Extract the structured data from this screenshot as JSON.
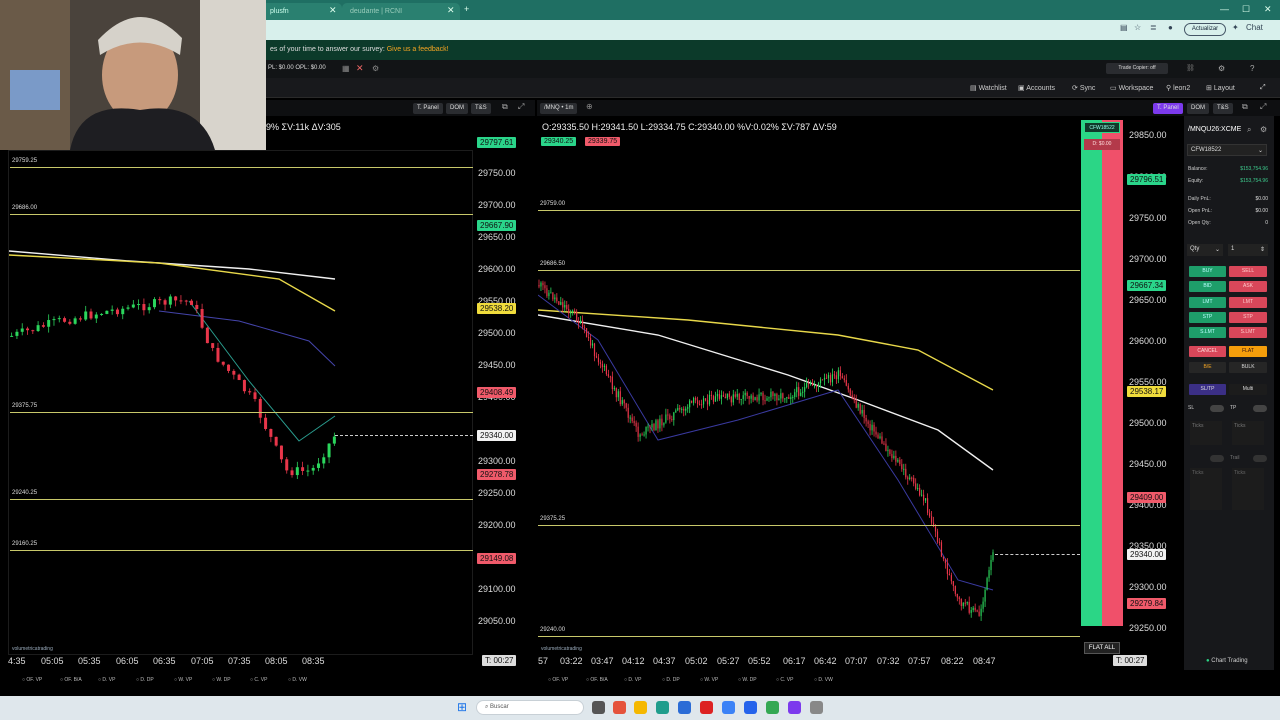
{
  "browser": {
    "tab1_title": "plusfn",
    "tab2_title": "deudante | RCNI",
    "actualizar_label": "Actualizar",
    "chat_label": "Chat"
  },
  "banner": {
    "text": "es of your time to answer our survey:",
    "link": "Give us a feedback!"
  },
  "toolbar": {
    "pnl_text": "PL: $0.00  OPL: $0.00",
    "trade_copier": "Trade Copier: off"
  },
  "nav": {
    "watchlist": "Watchlist",
    "accounts": "Accounts",
    "sync": "Sync",
    "workspace": "Workspace",
    "user": "leon2",
    "layout": "Layout"
  },
  "left_chart": {
    "buttons": [
      "T. Panel",
      "DOM",
      "T&S"
    ],
    "stats": "9%  ΣV:11k  ΔV:305",
    "levels": [
      {
        "price": "29759.25"
      },
      {
        "price": "29686.00"
      },
      {
        "price": "29375.75"
      },
      {
        "price": "29240.25"
      },
      {
        "price": "29160.25"
      }
    ],
    "price_labels": [
      "29750.00",
      "29700.00",
      "29650.00",
      "29600.00",
      "29550.00",
      "29500.00",
      "29450.00",
      "29400.00",
      "29300.00",
      "29250.00",
      "29200.00",
      "29100.00",
      "29050.00"
    ],
    "boxes": [
      {
        "text": "29797.61",
        "cls": "g"
      },
      {
        "text": "29667.90",
        "cls": "g"
      },
      {
        "text": "29538.20",
        "cls": "y"
      },
      {
        "text": "29408.49",
        "cls": "r"
      },
      {
        "text": "29340.00",
        "cls": "w"
      },
      {
        "text": "29278.78",
        "cls": "r"
      },
      {
        "text": "29149.08",
        "cls": "r"
      }
    ],
    "times": [
      "4:35",
      "05:05",
      "05:35",
      "06:05",
      "06:35",
      "07:05",
      "07:35",
      "08:05",
      "08:35"
    ],
    "timer": "T: 00:27",
    "watermark": "volumetricatrading",
    "bottom_items": [
      "OF. VP",
      "OF. B/A",
      "D. VP",
      "D. DP",
      "W. VP",
      "W. DP",
      "C. VP",
      "D. VW"
    ]
  },
  "right_chart": {
    "symbol": "/MNQ",
    "interval": "1m",
    "ohlc": "O:29335.50  H:29341.50  L:29334.75  C:29340.00  %V:0.02%  ΣV:787  ΔV:59",
    "bid_box": "29340.25",
    "ask_box": "29339.75",
    "buttons": [
      "T. Panel",
      "DOM",
      "T&S"
    ],
    "levels": [
      {
        "price": "29759.00"
      },
      {
        "price": "29686.50"
      },
      {
        "price": "29375.25"
      },
      {
        "price": "29240.00"
      }
    ],
    "price_labels": [
      "29850.00",
      "29800.00",
      "29750.00",
      "29700.00",
      "29650.00",
      "29600.00",
      "29550.00",
      "29500.00",
      "29450.00",
      "29400.00",
      "29350.00",
      "29300.00",
      "29250.00"
    ],
    "boxes": [
      {
        "text": "29796.51",
        "cls": "g"
      },
      {
        "text": "29667.34",
        "cls": "g"
      },
      {
        "text": "29538.17",
        "cls": "y"
      },
      {
        "text": "29409.00",
        "cls": "r"
      },
      {
        "text": "29340.00",
        "cls": "w"
      },
      {
        "text": "29279.84",
        "cls": "r"
      }
    ],
    "times": [
      "57",
      "03:22",
      "03:47",
      "04:12",
      "04:37",
      "05:02",
      "05:27",
      "05:52",
      "06:17",
      "06:42",
      "07:07",
      "07:32",
      "07:57",
      "08:22",
      "08:47"
    ],
    "timer": "T: 00:27",
    "account_badge": "CFW18522",
    "pnl_badge": "D: $0.00",
    "flat_all": "FLAT ALL",
    "watermark": "volumetricatrading",
    "bottom_items": [
      "OF. VP",
      "OF. B/A",
      "D. VP",
      "D. DP",
      "W. VP",
      "W. DP",
      "C. VP",
      "D. VW"
    ]
  },
  "trade_panel": {
    "symbol": "/MNQU26:XCME",
    "account": "CFW18522",
    "rows": [
      {
        "label": "Balance:",
        "value": "$153,754.96"
      },
      {
        "label": "Equity:",
        "value": "$153,754.96"
      },
      {
        "label": "Daily PnL:",
        "value": "$0.00"
      },
      {
        "label": "Open PnL:",
        "value": "$0.00"
      },
      {
        "label": "Open Qty:",
        "value": "0"
      }
    ],
    "qty_label": "Qty",
    "qty_value": "1",
    "order_buttons": [
      [
        "BUY",
        "SELL"
      ],
      [
        "BID",
        "ASK"
      ],
      [
        "LMT",
        "LMT"
      ],
      [
        "STP",
        "STP"
      ],
      [
        "S.LMT",
        "S.LMT"
      ]
    ],
    "cancel": "CANCEL",
    "flat": "FLAT",
    "be": "B/E",
    "bulk": "BULK",
    "sltp": "SL/TP",
    "multi": "Multi",
    "sl": "SL",
    "tp": "TP",
    "ticks": "Ticks",
    "trail": "Trail",
    "chart_trading": "Chart Trading"
  },
  "taskbar": {
    "search": "Buscar"
  },
  "colors": {
    "bull": "#2bd65c",
    "bear": "#e8364a",
    "ema_yellow": "#e8d84a",
    "ema_white": "#f0f0f0",
    "level_line": "#c8c86a"
  }
}
